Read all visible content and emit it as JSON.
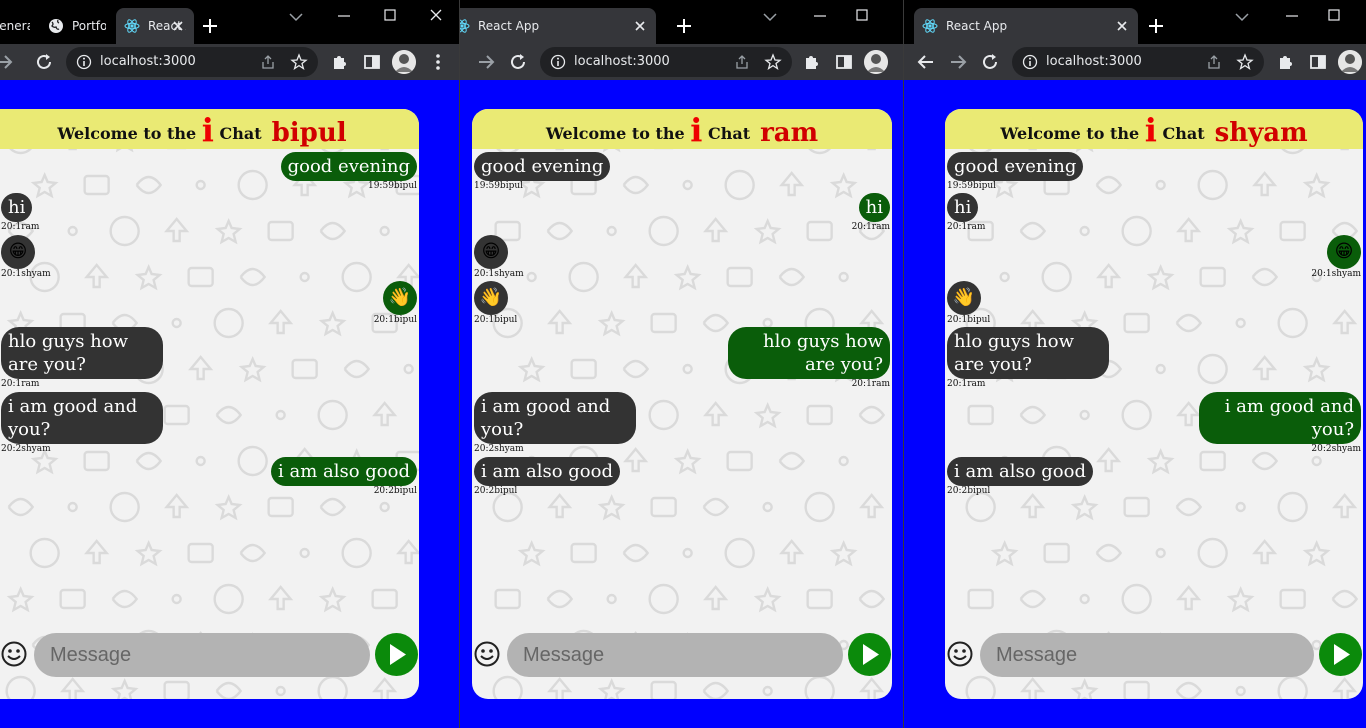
{
  "windows": [
    {
      "tabs": [
        {
          "label": "General",
          "active": false,
          "icon": "none"
        },
        {
          "label": "Portfolio",
          "active": false,
          "icon": "globe-icon"
        },
        {
          "label": "React App",
          "active": true,
          "icon": "react-icon"
        }
      ],
      "url": "localhost:3000",
      "header": {
        "welcome": "Welcome to the",
        "i": "i",
        "chat": "Chat",
        "user": "bipul"
      },
      "placeholder": "Message"
    },
    {
      "tabs": [
        {
          "label": "React App",
          "active": true,
          "icon": "react-icon"
        }
      ],
      "url": "localhost:3000",
      "header": {
        "welcome": "Welcome to the",
        "i": "i",
        "chat": "Chat",
        "user": "ram"
      },
      "placeholder": "Message"
    },
    {
      "tabs": [
        {
          "label": "React App",
          "active": true,
          "icon": "react-icon"
        }
      ],
      "url": "localhost:3000",
      "header": {
        "welcome": "Welcome to the",
        "i": "i",
        "chat": "Chat",
        "user": "shyam"
      },
      "placeholder": "Message"
    }
  ],
  "messages": [
    {
      "text": "good evening",
      "meta": "19:59bipul",
      "sender": "bipul",
      "type": "text"
    },
    {
      "text": "hi",
      "meta": "20:1ram",
      "sender": "ram",
      "type": "text"
    },
    {
      "text": "😁",
      "meta": "20:1shyam",
      "sender": "shyam",
      "type": "emoji",
      "icon": "grin-emoji"
    },
    {
      "text": "👋",
      "meta": "20:1bipul",
      "sender": "bipul",
      "type": "emoji",
      "icon": "wave-emoji"
    },
    {
      "text": "hlo guys how are you?",
      "meta": "20:1ram",
      "sender": "ram",
      "type": "text"
    },
    {
      "text": "i am good and you?",
      "meta": "20:2shyam",
      "sender": "shyam",
      "type": "text"
    },
    {
      "text": "i am also good",
      "meta": "20:2bipul",
      "sender": "bipul",
      "type": "text"
    }
  ],
  "colors": {
    "page_bg": "#0000ff",
    "header_bg": "#eaea74",
    "accent_red": "#d10000",
    "incoming_bubble": "#333333",
    "outgoing_bubble": "#0a5d0a",
    "send_button": "#0b8a0b",
    "input_bg": "#b3b3b3"
  }
}
